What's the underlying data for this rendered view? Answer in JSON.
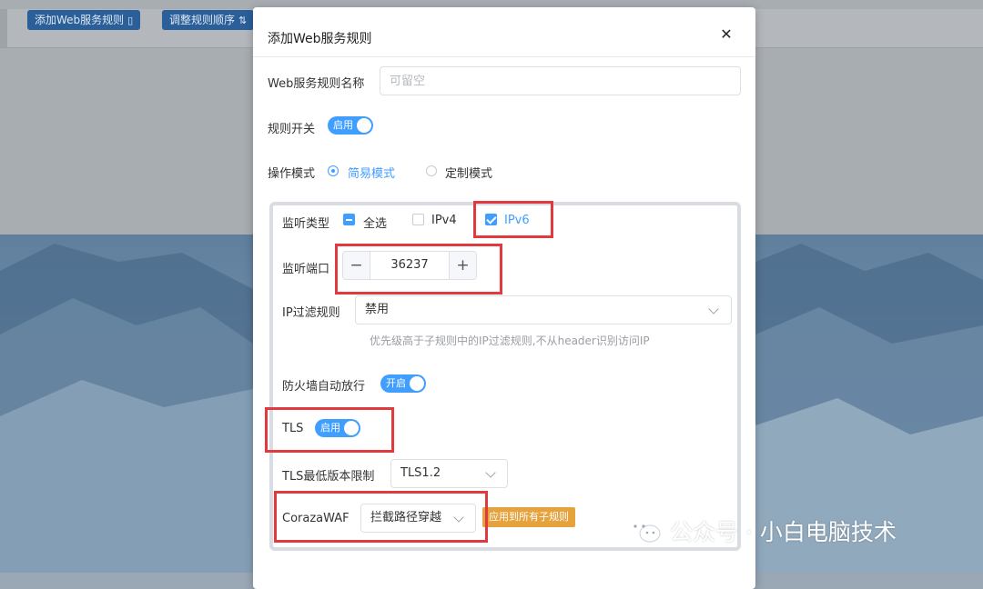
{
  "background": {
    "toolbar_buttons": [
      {
        "label": "添加Web服务规则",
        "icon": "document-icon"
      },
      {
        "label": "调整规则顺序",
        "icon": "sort-icon"
      }
    ]
  },
  "modal": {
    "title": "添加Web服务规则",
    "close_icon": "close-icon",
    "rule_name": {
      "label": "Web服务规则名称",
      "placeholder": "可留空",
      "value": ""
    },
    "rule_switch": {
      "label": "规则开关",
      "state_text": "启用",
      "on": true
    },
    "mode": {
      "label": "操作模式",
      "options": [
        {
          "label": "简易模式",
          "selected": true
        },
        {
          "label": "定制模式",
          "selected": false
        }
      ]
    },
    "listen_type": {
      "label": "监听类型",
      "options": [
        {
          "label": "全选",
          "state": "indeterminate"
        },
        {
          "label": "IPv4",
          "state": "unchecked"
        },
        {
          "label": "IPv6",
          "state": "checked"
        }
      ]
    },
    "listen_port": {
      "label": "监听端口",
      "value": "36237",
      "minus": "−",
      "plus": "+"
    },
    "ip_filter": {
      "label": "IP过滤规则",
      "value": "禁用",
      "hint": "优先级高于子规则中的IP过滤规则,不从header识别访问IP"
    },
    "firewall": {
      "label": "防火墙自动放行",
      "state_text": "开启",
      "on": true
    },
    "tls": {
      "label": "TLS",
      "state_text": "启用",
      "on": true
    },
    "tls_min": {
      "label": "TLS最低版本限制",
      "value": "TLS1.2"
    },
    "waf": {
      "label": "CorazaWAF",
      "value": "拦截路径穿越",
      "apply_button": "应用到所有子规则"
    }
  },
  "watermark": {
    "text": "公众号 · 小白电脑技术",
    "icon": "wechat-icon"
  },
  "colors": {
    "accent": "#409eff",
    "highlight": "#e0393e",
    "tag": "#e6a23c"
  }
}
